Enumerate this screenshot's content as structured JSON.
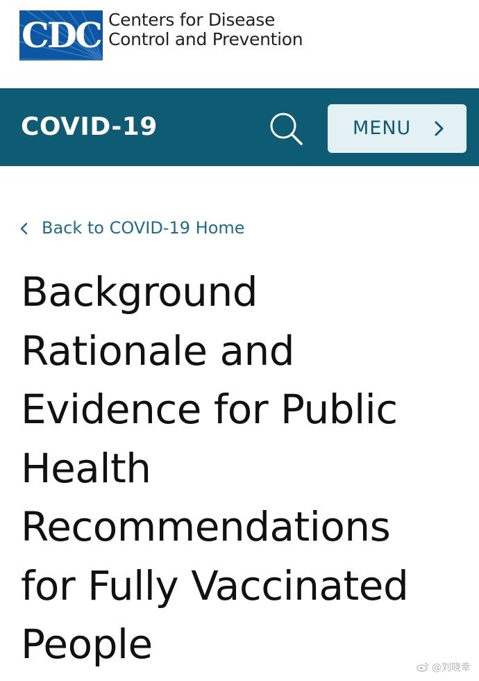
{
  "logo": {
    "letters": "CDC",
    "agency_line1": "Centers for Disease",
    "agency_line2": "Control and Prevention"
  },
  "nav": {
    "site_title": "COVID-19",
    "search_icon": "search-icon",
    "menu_label": "MENU",
    "menu_icon": "chevron-right-icon"
  },
  "back_link": {
    "label": "Back to COVID-19 Home",
    "icon": "chevron-left-icon"
  },
  "page": {
    "title_lines": [
      "Background",
      "Rationale and",
      "Evidence for Public",
      "Health",
      "Recommendations",
      "for Fully Vaccinated",
      "People"
    ]
  },
  "watermark": {
    "text": "@刘晓幸"
  },
  "colors": {
    "logo_blue": "#0b57a4",
    "nav_teal": "#0e5c73",
    "menu_button_bg": "#e4f1f4",
    "link_blue": "#1d6d8e",
    "title_text": "#111111"
  }
}
